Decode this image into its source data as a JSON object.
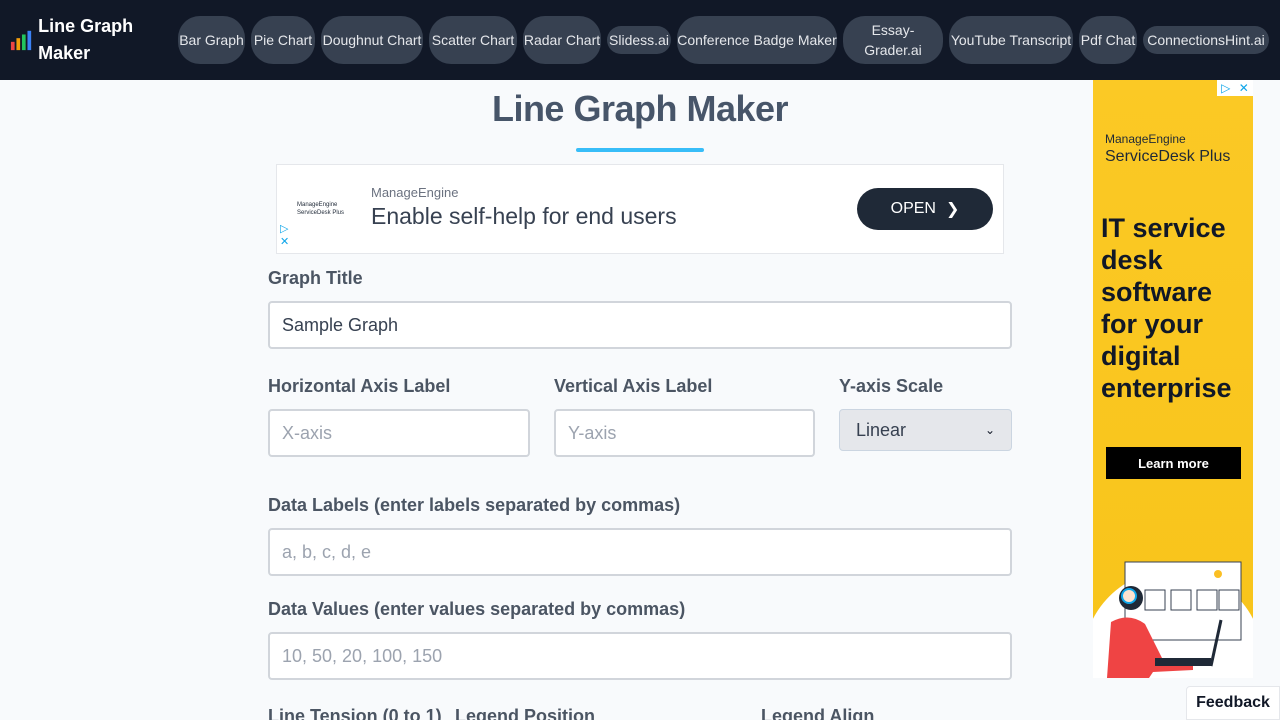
{
  "brand": {
    "name": "Line Graph Maker"
  },
  "nav": {
    "items": [
      {
        "label": "Bar Graph"
      },
      {
        "label": "Pie Chart"
      },
      {
        "label": "Doughnut Chart"
      },
      {
        "label": "Scatter Chart"
      },
      {
        "label": "Radar Chart"
      },
      {
        "label": "Slidess.ai"
      },
      {
        "label": "Conference Badge Maker"
      },
      {
        "label": "Essay-Grader.ai"
      },
      {
        "label": "YouTube Transcript"
      },
      {
        "label": "Pdf Chat"
      },
      {
        "label": "ConnectionsHint.ai"
      }
    ]
  },
  "page": {
    "title": "Line Graph Maker"
  },
  "ad_top": {
    "logo_line1": "ManageEngine",
    "logo_line2": "ServiceDesk Plus",
    "brand": "ManageEngine",
    "headline": "Enable self-help for end users",
    "button": "OPEN"
  },
  "form": {
    "graph_title": {
      "label": "Graph Title",
      "value": "Sample Graph"
    },
    "x_axis": {
      "label": "Horizontal Axis Label",
      "placeholder": "X-axis"
    },
    "y_axis": {
      "label": "Vertical Axis Label",
      "placeholder": "Y-axis"
    },
    "y_scale": {
      "label": "Y-axis Scale",
      "selected": "Linear"
    },
    "data_labels": {
      "label": "Data Labels (enter labels separated by commas)",
      "placeholder": "a, b, c, d, e"
    },
    "data_values": {
      "label": "Data Values (enter values separated by commas)",
      "placeholder": "10, 50, 20, 100, 150"
    },
    "line_tension": {
      "label": "Line Tension (0 to 1)"
    },
    "legend_position": {
      "label": "Legend Position"
    },
    "legend_align": {
      "label": "Legend Align"
    }
  },
  "ad_side": {
    "brand": "ManageEngine",
    "product": "ServiceDesk Plus",
    "headline": "IT service desk software for your digital enterprise",
    "button": "Learn more"
  },
  "feedback": {
    "label": "Feedback"
  },
  "colors": {
    "nav_bg": "#111827",
    "pill_bg": "#374151",
    "accent": "#38bdf8",
    "ad_yellow": "#fbc925"
  }
}
